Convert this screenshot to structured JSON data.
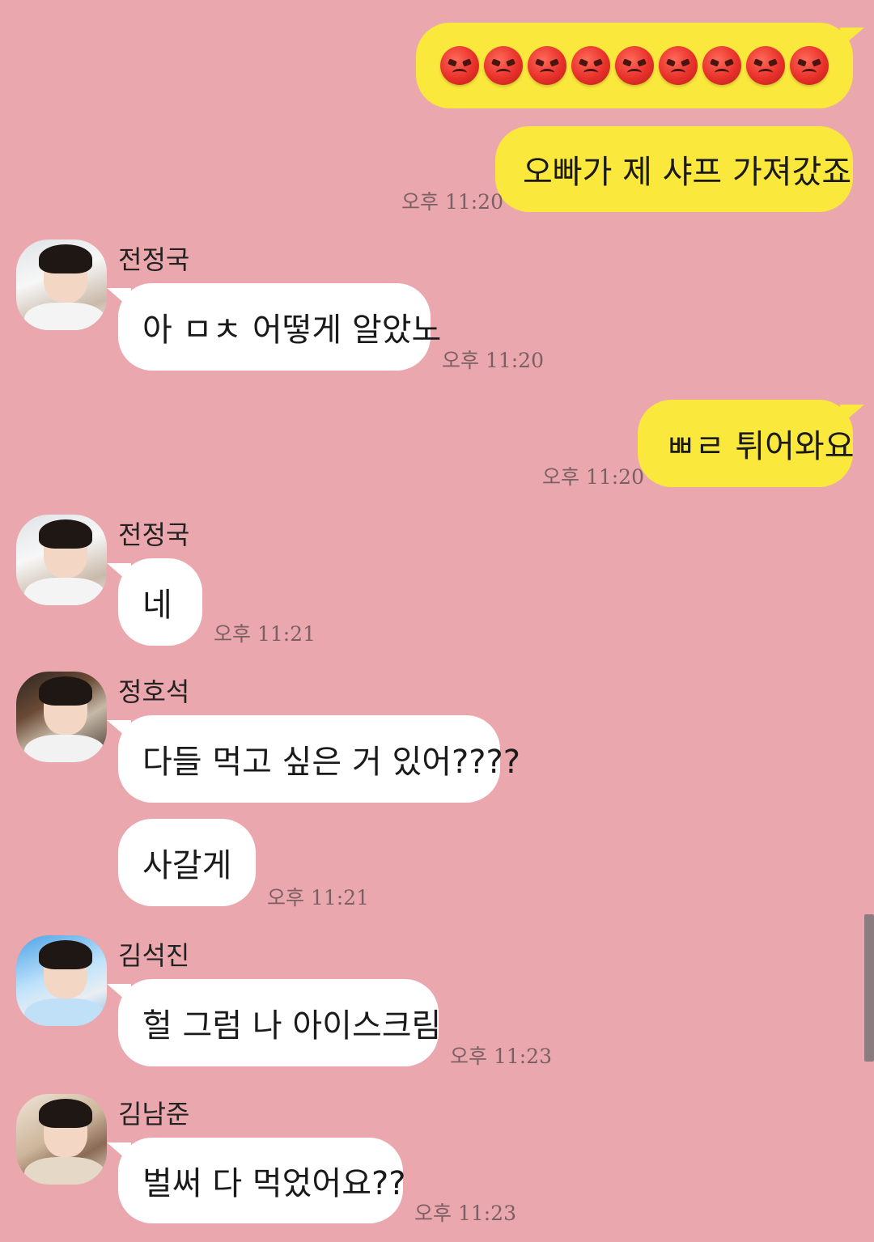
{
  "messages": {
    "m1": {
      "emoji_count": 9,
      "emoji": "angry-face"
    },
    "m2": {
      "text": "오빠가 제 샤프 가져갔죠",
      "time": "오후 11:20"
    },
    "m3": {
      "sender": "전정국",
      "text": "아 ㅁㅊ 어떻게 알았노",
      "time": "오후 11:20"
    },
    "m4": {
      "text": "ㅃㄹ 튀어와요",
      "time": "오후 11:20"
    },
    "m5": {
      "sender": "전정국",
      "text": "네",
      "time": "오후 11:21"
    },
    "m6": {
      "sender": "정호석",
      "text": "다들 먹고 싶은 거 있어????"
    },
    "m7": {
      "text": "사갈게",
      "time": "오후 11:21"
    },
    "m8": {
      "sender": "김석진",
      "text": "헐 그럼 나 아이스크림",
      "time": "오후 11:23"
    },
    "m9": {
      "sender": "김남준",
      "text": "벌써 다 먹었어요??",
      "time": "오후 11:23"
    }
  },
  "colors": {
    "background": "#eba7ae",
    "my_bubble": "#fbe83c",
    "their_bubble": "#ffffff"
  }
}
